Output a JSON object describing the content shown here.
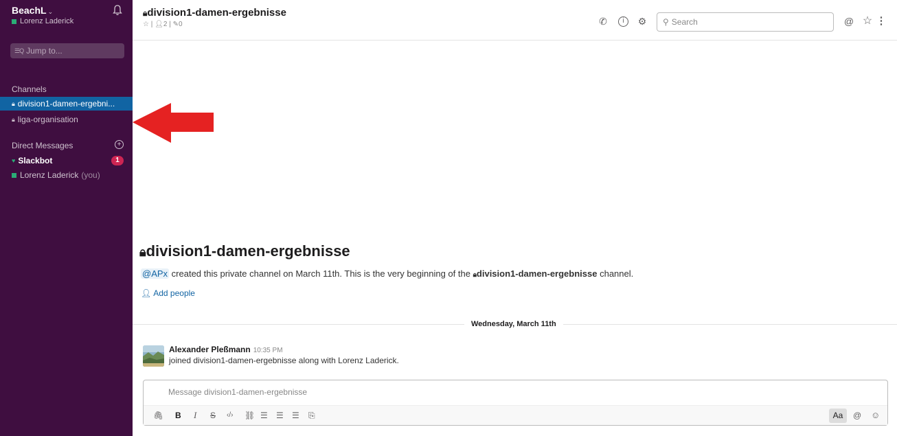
{
  "workspace": {
    "name": "BeachL",
    "user": "Lorenz Laderick",
    "jump_label": "Jump to..."
  },
  "sidebar": {
    "channels_title": "Channels",
    "channels": [
      {
        "label": "division1-damen-ergebni..."
      },
      {
        "label": "liga-organisation"
      }
    ],
    "dm_title": "Direct Messages",
    "dms": [
      {
        "label": "Slackbot",
        "badge": "1"
      },
      {
        "label": "Lorenz Laderick",
        "suffix": "(you)"
      }
    ]
  },
  "header": {
    "channel_name": "division1-damen-ergebnisse",
    "members": "2",
    "pins": "0",
    "search_placeholder": "Search"
  },
  "intro": {
    "title": "division1-damen-ergebnisse",
    "mention": "@APx",
    "text_before": "created this private channel on March 11th. This is the very beginning of the",
    "channel_ref": "division1-damen-ergebnisse",
    "text_after": "channel.",
    "add_people": "Add people"
  },
  "day_divider": "Wednesday, March 11th",
  "message": {
    "author": "Alexander Pleßmann",
    "time": "10:35 PM",
    "text": "joined division1-damen-ergebnisse along with Lorenz Laderick."
  },
  "composer": {
    "placeholder": "Message division1-damen-ergebnisse",
    "aa_label": "Aa"
  },
  "colors": {
    "sidebar_bg": "#3f0e40",
    "active_channel": "#1164a3",
    "presence_green": "#2bac76",
    "badge_red": "#cd2553",
    "annotation_arrow": "#e52222"
  }
}
